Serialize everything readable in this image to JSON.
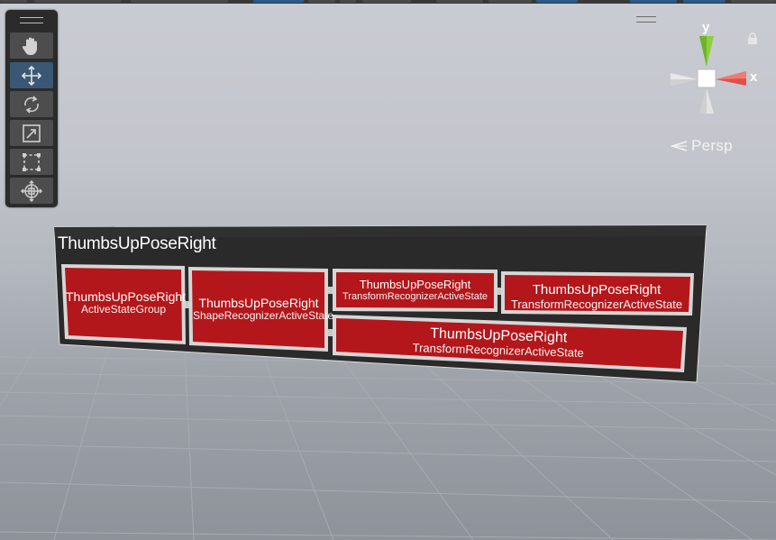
{
  "scene": {
    "panel_title": "ThumbsUpPoseRight",
    "cards": [
      {
        "title": "ThumbsUpPoseRight",
        "subtitle": "ActiveStateGroup"
      },
      {
        "title": "ThumbsUpPoseRight",
        "subtitle": "ShapeRecognizerActiveState"
      },
      {
        "title": "ThumbsUpPoseRight",
        "subtitle": "TransformRecognizerActiveState"
      },
      {
        "title": "ThumbsUpPoseRight",
        "subtitle": "TransformRecognizerActiveState"
      },
      {
        "title": "ThumbsUpPoseRight",
        "subtitle": "TransformRecognizerActiveState"
      }
    ]
  },
  "tools": {
    "items": [
      {
        "icon": "hand-tool-icon"
      },
      {
        "icon": "move-tool-icon",
        "active": true
      },
      {
        "icon": "rotate-tool-icon"
      },
      {
        "icon": "scale-tool-icon"
      },
      {
        "icon": "rect-tool-icon"
      },
      {
        "icon": "transform-tool-icon"
      }
    ]
  },
  "gizmo": {
    "y_label": "y",
    "x_label": "x",
    "projection_label": "Persp"
  },
  "colors": {
    "card_red": "#b3171b",
    "panel_dark": "#2c2c2c",
    "active_tool": "#3a5875",
    "gizmo_x": "#e0504a",
    "gizmo_y": "#8cd13c"
  }
}
